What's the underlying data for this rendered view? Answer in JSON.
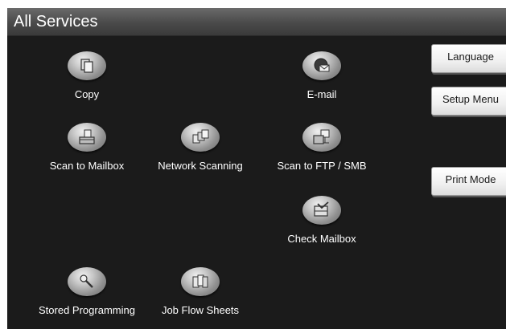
{
  "title": "All Services",
  "services": [
    {
      "label": "Copy",
      "icon": "copy-icon"
    },
    {
      "label": "E-mail",
      "icon": "email-icon"
    },
    {
      "label": "Scan to Mailbox",
      "icon": "scan-to-mailbox-icon"
    },
    {
      "label": "Network Scanning",
      "icon": "network-scanning-icon"
    },
    {
      "label": "Scan to FTP / SMB",
      "icon": "scan-to-ftp-smb-icon"
    },
    {
      "label": "Check Mailbox",
      "icon": "check-mailbox-icon"
    },
    {
      "label": "Stored Programming",
      "icon": "stored-programming-icon"
    },
    {
      "label": "Job Flow Sheets",
      "icon": "job-flow-sheets-icon"
    }
  ],
  "side_buttons": {
    "language": "Language",
    "setup_menu": "Setup Menu",
    "print_mode": "Print Mode"
  },
  "colors": {
    "screen_background": "#1b1b1b",
    "title_bar": "#4a4a4a",
    "text": "#ffffff",
    "button_face": "#f0f0f0"
  }
}
